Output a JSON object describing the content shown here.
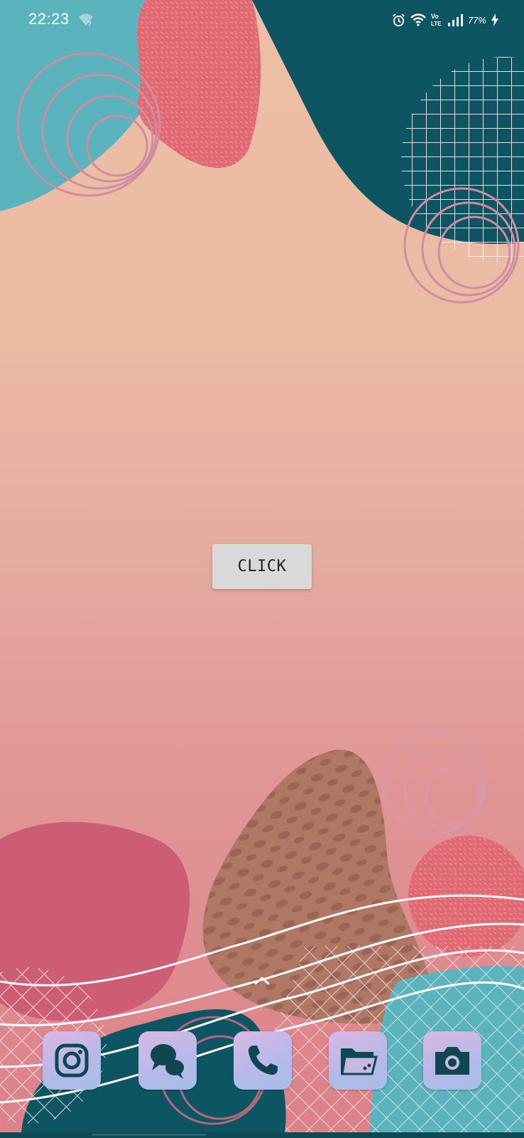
{
  "status_bar": {
    "time": "22:23",
    "battery_percent": "77%",
    "icons": [
      "wifi-question-icon",
      "alarm-icon",
      "wifi-icon",
      "volte-icon",
      "signal-icon",
      "battery-charging-icon"
    ],
    "volte_top": "Vo",
    "volte_bottom": "LTE"
  },
  "main": {
    "button_label": "CLICK"
  },
  "dock": {
    "apps": [
      {
        "name": "Instagram",
        "icon": "instagram-icon"
      },
      {
        "name": "Messages",
        "icon": "chat-bubbles-icon"
      },
      {
        "name": "Phone",
        "icon": "phone-icon"
      },
      {
        "name": "Files",
        "icon": "folder-icon"
      },
      {
        "name": "Camera",
        "icon": "camera-icon"
      }
    ]
  },
  "colors": {
    "teal_light": "#5ab3bd",
    "teal_dark": "#0e5563",
    "coral": "#e06977",
    "rose": "#cc5d75",
    "brown": "#b07864",
    "peach_bg": "#ecbfa4",
    "button_bg": "#d9d9d9",
    "dock_icon_glyph": "#0f4652"
  }
}
